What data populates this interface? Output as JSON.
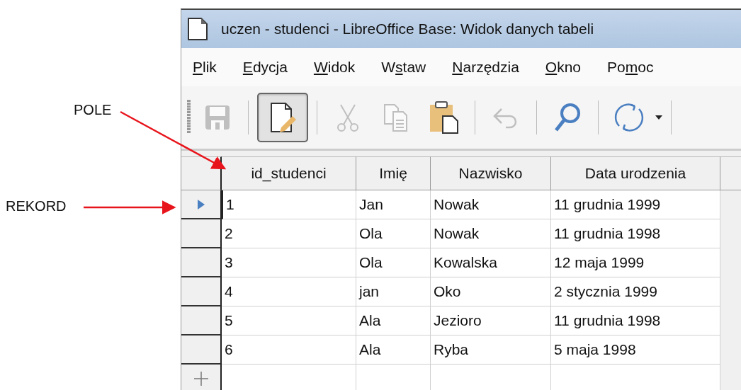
{
  "annotations": [
    {
      "label": "POLE",
      "kind": "field"
    },
    {
      "label": "REKORD",
      "kind": "record"
    }
  ],
  "window": {
    "title": "uczen - studenci - LibreOffice Base: Widok danych tabeli"
  },
  "menu": [
    {
      "key": "P",
      "post": "lik"
    },
    {
      "key": "E",
      "post": "dycja"
    },
    {
      "key": "W",
      "post": "idok"
    },
    {
      "pre": "W",
      "key": "s",
      "post": "taw"
    },
    {
      "key": "N",
      "post": "arzędzia"
    },
    {
      "key": "O",
      "post": "kno"
    },
    {
      "pre": "Po",
      "key": "m",
      "post": "oc"
    }
  ],
  "toolbar": [
    {
      "kind": "save",
      "disabled": true,
      "pressed": false
    },
    {
      "kind": "edit",
      "disabled": false,
      "pressed": true
    },
    {
      "kind": "cut",
      "disabled": true,
      "pressed": false
    },
    {
      "kind": "copy",
      "disabled": true,
      "pressed": false
    },
    {
      "kind": "paste",
      "disabled": false,
      "pressed": false
    },
    {
      "kind": "undo",
      "disabled": true,
      "pressed": false
    },
    {
      "kind": "find",
      "disabled": false,
      "pressed": false
    },
    {
      "kind": "refresh",
      "disabled": false,
      "pressed": false
    }
  ],
  "table": {
    "columns": [
      "id_studenci",
      "Imię",
      "Nazwisko",
      "Data urodzenia"
    ],
    "rows": [
      {
        "selected": true,
        "cells": [
          "1",
          "Jan",
          "Nowak",
          "11 grudnia 1999"
        ]
      },
      {
        "selected": false,
        "cells": [
          "2",
          "Ola",
          "Nowak",
          "11 grudnia 1998"
        ]
      },
      {
        "selected": false,
        "cells": [
          "3",
          "Ola",
          "Kowalska",
          "12 maja 1999"
        ]
      },
      {
        "selected": false,
        "cells": [
          "4",
          "jan",
          "Oko",
          "2 stycznia 1999"
        ]
      },
      {
        "selected": false,
        "cells": [
          "5",
          "Ala",
          "Jezioro",
          "11 grudnia 1998"
        ]
      },
      {
        "selected": false,
        "cells": [
          "6",
          "Ala",
          "Ryba",
          "5 maja 1998"
        ]
      }
    ]
  }
}
